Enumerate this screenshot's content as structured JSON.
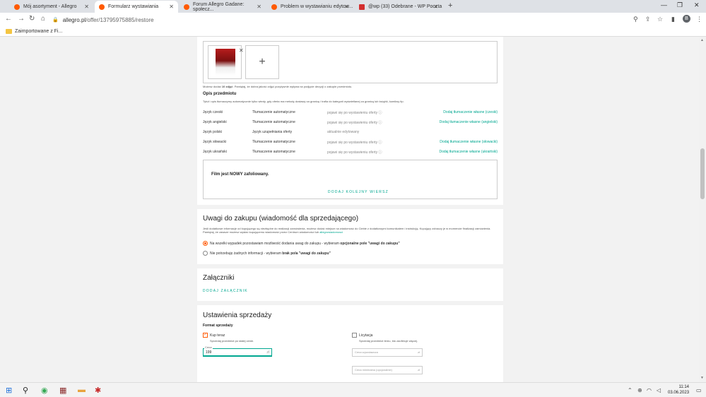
{
  "browser": {
    "tabs": [
      {
        "title": "Mój asortyment - Allegro",
        "fav": "#ff5a00"
      },
      {
        "title": "Formularz wystawiania",
        "fav": "#ff5a00"
      },
      {
        "title": "Forum Allegro Gadane: społecz...",
        "fav": "#ff5a00"
      },
      {
        "title": "Problem w wystawianiu edytow...",
        "fav": "#ff5a00"
      },
      {
        "title": "@wp (33) Odebrane - WP Poczta",
        "fav": "#d32f2f"
      }
    ],
    "url_domain": "allegro.pl",
    "url_path": "/offer/13795975885/restore",
    "bookmark": "Zaimportowane z Fi...",
    "profile_initial": "B"
  },
  "photos_note_pre": "Możesz dodać ",
  "photos_note_bold": "10 zdjęć",
  "photos_note_post": ". Pamiętaj, że dobra jakość zdjęć pozytywnie wpływa na podjęcie decyzji o zakupie przedmiotu.",
  "opis": {
    "title": "Opis przedmiotu",
    "info": "Tytuł i opis tłumaczymy automatycznie tylko wtedy, gdy oferta ma metodę dostawy za granicę i trafia do kategorii wyświetlanej za granicą lub książki, komiksy itp.",
    "rows": [
      {
        "lang": "Język czeski",
        "mode": "Tłumaczenie automatyczne",
        "status": "pojawi się po wystawieniu oferty ⓘ",
        "action": "Dodaj tłumaczenie własne (czeski)"
      },
      {
        "lang": "Język angielski",
        "mode": "Tłumaczenie automatyczne",
        "status": "pojawi się po wystawieniu oferty ⓘ",
        "action": "Dodaj tłumaczenie własne (angielski)"
      },
      {
        "lang": "Język polski",
        "mode": "Język uzupełniania oferty",
        "status": "aktualnie edytowany",
        "action": ""
      },
      {
        "lang": "Język słowacki",
        "mode": "Tłumaczenie automatyczne",
        "status": "pojawi się po wystawieniu oferty ⓘ",
        "action": "Dodaj tłumaczenie własne (słowacki)"
      },
      {
        "lang": "Język ukraiński",
        "mode": "Tłumaczenie automatyczne",
        "status": "pojawi się po wystawieniu oferty ⓘ",
        "action": "Dodaj tłumaczenie własne (ukraiński)"
      }
    ],
    "description_text": "Film jest NOWY zafoliowany.",
    "add_row": "DODAJ KOLEJNY WIERSZ"
  },
  "uwagi": {
    "title": "Uwagi do zakupu (wiadomość dla sprzedającego)",
    "info": "Jeśli dodatkowe informacje od kupującego są niezbędne do realizacji zamówienia, możesz dodać miejsce na wiadomość do Ciebie z dodatkowymi komunikatem i instrukcją. Kupujący zobaczy je w momencie finalizacji zamówienia. Pamiętaj, że zawsze możesz wysłać kupującemu wiadomość przez Centrum wiadomości lub",
    "info_link": "allegrowiadomosci",
    "opt1_pre": "Na wszelki wypadek pozostawiam możliwość dodania uwag do zakupu - wybieram ",
    "opt1_bold": "opcjonalne pole \"uwagi do zakupu\"",
    "opt2_pre": "Nie potrzebuję żadnych informacji - wybieram ",
    "opt2_bold": "brak pola \"uwagi do zakupu\""
  },
  "zalaczniki": {
    "title": "Załączniki",
    "add": "DODAJ ZAŁĄCZNIK"
  },
  "sprzedaz": {
    "title": "Ustawienia sprzedaży",
    "format_label": "Format sprzedaży",
    "buy_now": "Kup teraz",
    "buy_now_sub": "Sprzedaj przedmiot po stałej cenie.",
    "auction": "Licytacja",
    "auction_sub": "Sprzedaj przedmiot temu, kto zaoferuje więcej.",
    "price_label": "Cena",
    "price_value": "199",
    "currency": "zł",
    "auction_price_placeholder": "Cena wywoławcza",
    "min_price_placeholder": "Cena minimalna (opcjonalnie)"
  },
  "taskbar": {
    "time": "11:14",
    "date": "03.06.2023"
  }
}
